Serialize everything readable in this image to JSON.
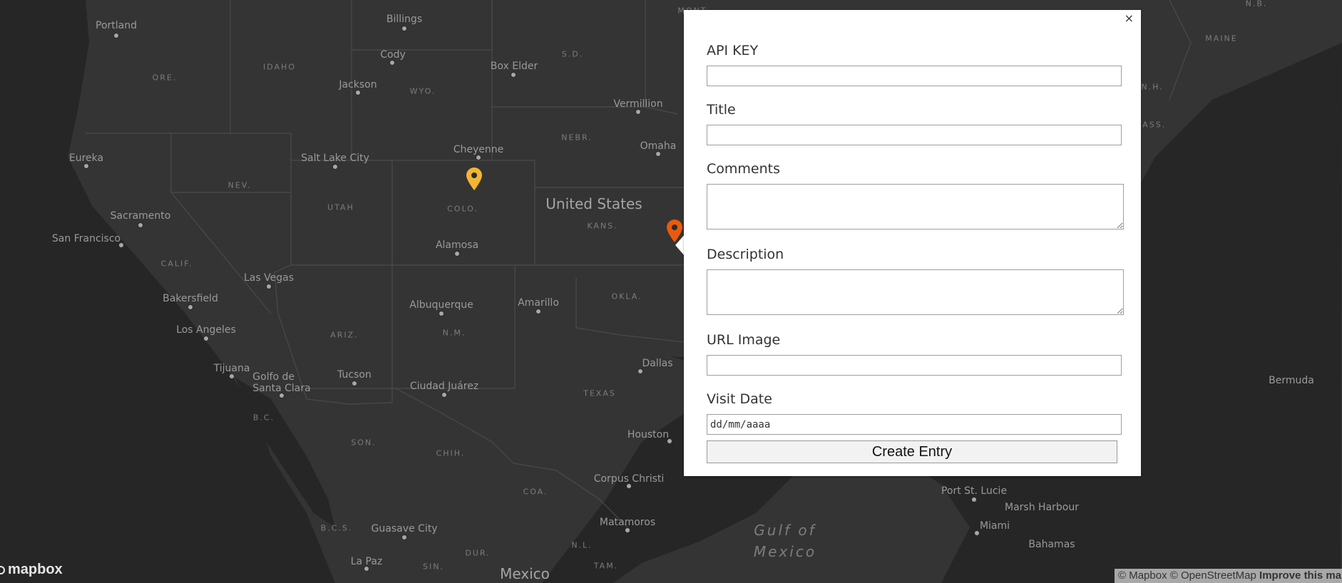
{
  "map": {
    "places": [
      {
        "name": "Portland",
        "kind": "city"
      },
      {
        "name": "Billings",
        "kind": "city"
      },
      {
        "name": "Cody",
        "kind": "city"
      },
      {
        "name": "Jackson",
        "kind": "city"
      },
      {
        "name": "Box Elder",
        "kind": "city"
      },
      {
        "name": "Vermillion",
        "kind": "city"
      },
      {
        "name": "Omaha",
        "kind": "city"
      },
      {
        "name": "Cheyenne",
        "kind": "city"
      },
      {
        "name": "Salt Lake City",
        "kind": "city"
      },
      {
        "name": "Eureka",
        "kind": "city"
      },
      {
        "name": "Sacramento",
        "kind": "city"
      },
      {
        "name": "San Francisco",
        "kind": "city"
      },
      {
        "name": "Alamosa",
        "kind": "city"
      },
      {
        "name": "Las Vegas",
        "kind": "city"
      },
      {
        "name": "Bakersfield",
        "kind": "city"
      },
      {
        "name": "Los Angeles",
        "kind": "city"
      },
      {
        "name": "Albuquerque",
        "kind": "city"
      },
      {
        "name": "Amarillo",
        "kind": "city"
      },
      {
        "name": "Tijuana",
        "kind": "city"
      },
      {
        "name": "Golfo de\nSanta Clara",
        "kind": "city"
      },
      {
        "name": "Tucson",
        "kind": "city"
      },
      {
        "name": "Ciudad Juárez",
        "kind": "city"
      },
      {
        "name": "Dallas",
        "kind": "city"
      },
      {
        "name": "Houston",
        "kind": "city"
      },
      {
        "name": "Corpus Christi",
        "kind": "city"
      },
      {
        "name": "Matamoros",
        "kind": "city"
      },
      {
        "name": "Guasave City",
        "kind": "city"
      },
      {
        "name": "La Paz",
        "kind": "city"
      },
      {
        "name": "Port St. Lucie",
        "kind": "city"
      },
      {
        "name": "Marsh Harbour",
        "kind": "city"
      },
      {
        "name": "Miami",
        "kind": "city"
      },
      {
        "name": "Bahamas",
        "kind": "city"
      },
      {
        "name": "Bermuda",
        "kind": "city"
      },
      {
        "name": "MONT.",
        "kind": "state"
      },
      {
        "name": "IDAHO",
        "kind": "state"
      },
      {
        "name": "ORE.",
        "kind": "state"
      },
      {
        "name": "WYO.",
        "kind": "state"
      },
      {
        "name": "S.D.",
        "kind": "state"
      },
      {
        "name": "NEBR.",
        "kind": "state"
      },
      {
        "name": "NEV.",
        "kind": "state"
      },
      {
        "name": "UTAH",
        "kind": "state"
      },
      {
        "name": "COLO.",
        "kind": "state"
      },
      {
        "name": "KANS.",
        "kind": "state"
      },
      {
        "name": "CALIF.",
        "kind": "state"
      },
      {
        "name": "ARIZ.",
        "kind": "state"
      },
      {
        "name": "N.M.",
        "kind": "state"
      },
      {
        "name": "OKLA.",
        "kind": "state"
      },
      {
        "name": "TEXAS",
        "kind": "state"
      },
      {
        "name": "B.C.",
        "kind": "state"
      },
      {
        "name": "SON.",
        "kind": "state"
      },
      {
        "name": "CHIH.",
        "kind": "state"
      },
      {
        "name": "COA.",
        "kind": "state"
      },
      {
        "name": "B.C.S.",
        "kind": "state"
      },
      {
        "name": "DUR.",
        "kind": "state"
      },
      {
        "name": "N.L.",
        "kind": "state"
      },
      {
        "name": "TAM.",
        "kind": "state"
      },
      {
        "name": "SIN.",
        "kind": "state"
      },
      {
        "name": "MAINE",
        "kind": "state"
      },
      {
        "name": "N.H.",
        "kind": "state"
      },
      {
        "name": "N.B.",
        "kind": "state"
      },
      {
        "name": "MASS.",
        "kind": "state"
      },
      {
        "name": "United States",
        "kind": "country"
      },
      {
        "name": "Mexico",
        "kind": "country"
      },
      {
        "name": "Gulf of\nMexico",
        "kind": "sea"
      }
    ],
    "markers": [
      {
        "name": "colorado-marker",
        "color": "#f2b632"
      },
      {
        "name": "kansas-marker",
        "color": "#ea5a0c"
      }
    ]
  },
  "form": {
    "close_label": "×",
    "api_key_label": "API KEY",
    "title_label": "Title",
    "comments_label": "Comments",
    "description_label": "Description",
    "image_label": "URL Image",
    "visit_date_label": "Visit Date",
    "visit_date_value": "dd/mm/aaaa",
    "submit_label": "Create Entry"
  },
  "branding": {
    "logo_text": "mapbox",
    "attribution": "© Mapbox © OpenStreetMap",
    "improve_link": "Improve this map"
  }
}
